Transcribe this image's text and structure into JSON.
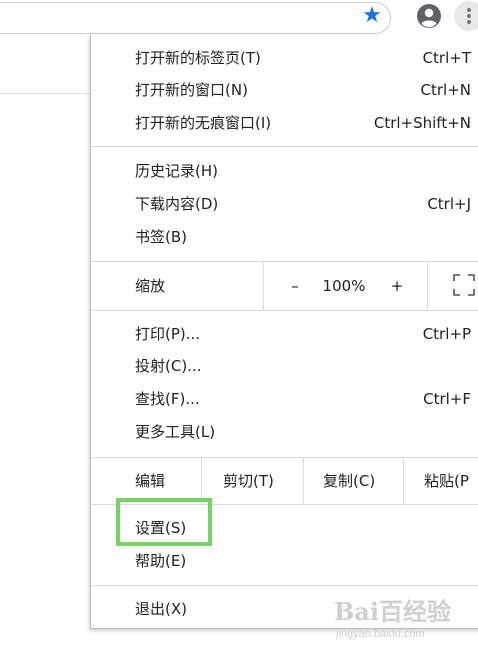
{
  "toolbar": {
    "bookmark_icon": "star-icon",
    "profile_icon": "account-circle-icon",
    "menu_icon": "three-dot-menu-icon",
    "accent_color": "#1a73e8"
  },
  "menu": {
    "new_tab": {
      "label": "打开新的标签页(T)",
      "shortcut": "Ctrl+T"
    },
    "new_window": {
      "label": "打开新的窗口(N)",
      "shortcut": "Ctrl+N"
    },
    "new_incognito": {
      "label": "打开新的无痕窗口(I)",
      "shortcut": "Ctrl+Shift+N"
    },
    "history": {
      "label": "历史记录(H)"
    },
    "downloads": {
      "label": "下载内容(D)",
      "shortcut": "Ctrl+J"
    },
    "bookmarks": {
      "label": "书签(B)"
    },
    "zoom": {
      "label": "缩放",
      "minus": "–",
      "value": "100%",
      "plus": "+",
      "fullscreen_icon": "fullscreen-icon"
    },
    "print": {
      "label": "打印(P)...",
      "shortcut": "Ctrl+P"
    },
    "cast": {
      "label": "投射(C)..."
    },
    "find": {
      "label": "查找(F)...",
      "shortcut": "Ctrl+F"
    },
    "more_tools": {
      "label": "更多工具(L)"
    },
    "edit": {
      "label": "编辑",
      "cut": "剪切(T)",
      "copy": "复制(C)",
      "paste": "粘贴(P"
    },
    "settings": {
      "label": "设置(S)"
    },
    "help": {
      "label": "帮助(E)"
    },
    "exit": {
      "label": "退出(X)"
    }
  },
  "annotation": {
    "highlight_color": "#74d465"
  },
  "watermark": {
    "brand": "Bai百经验",
    "url": "jingyan.baidu.com"
  }
}
